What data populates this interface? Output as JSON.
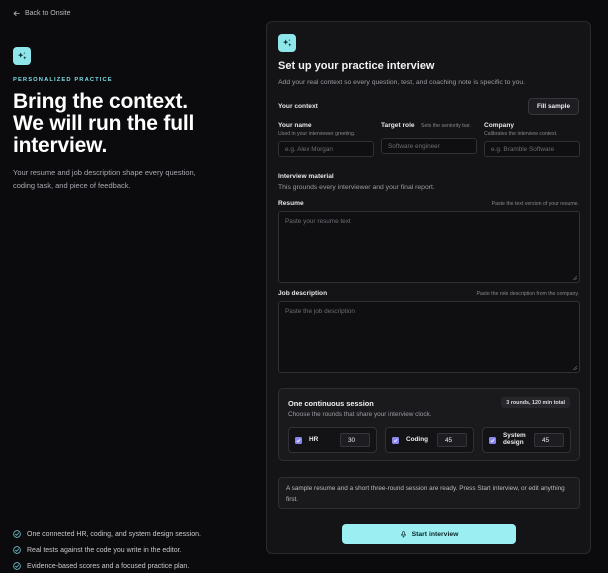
{
  "nav": {
    "back_label": "Back to Onsite"
  },
  "hero": {
    "kicker": "PERSONALIZED PRACTICE",
    "headline_lines": [
      "Bring the context.",
      "We will run the full",
      "interview."
    ],
    "lede": "Your resume and job description shape every question, coding task, and piece of feedback."
  },
  "features": [
    "One connected HR, coding, and system design session.",
    "Real tests against the code you write in the editor.",
    "Evidence-based scores and a focused practice plan."
  ],
  "form": {
    "title": "Set up your practice interview",
    "subtitle": "Add your real context so every question, test, and coaching note is specific to you.",
    "context_label": "Your context",
    "fill_sample": "Fill sample",
    "name": {
      "label": "Your name",
      "hint": "Used in your interviewer greeting.",
      "placeholder": "e.g. Alex Morgan"
    },
    "role": {
      "label": "Target role",
      "hint": "Sets the seniority bar.",
      "placeholder": "Software engineer"
    },
    "company": {
      "label": "Company",
      "hint": "Calibrates the interview context.",
      "placeholder": "e.g. Bramble Software"
    },
    "material": {
      "label": "Interview material",
      "sub": "This grounds every interviewer and your final report."
    },
    "resume": {
      "label": "Resume",
      "hint": "Paste the text version of your resume.",
      "placeholder": "Paste your resume text"
    },
    "job": {
      "label": "Job description",
      "hint": "Paste the role description from the company.",
      "placeholder": "Paste the job description"
    },
    "session": {
      "title": "One continuous session",
      "badge": "3 rounds, 120 min total",
      "sub": "Choose the rounds that share your interview clock.",
      "rounds": [
        {
          "name": "HR",
          "minutes": "30",
          "checked": true
        },
        {
          "name": "Coding",
          "minutes": "45",
          "checked": true
        },
        {
          "name": "System design",
          "minutes": "45",
          "checked": true
        }
      ]
    },
    "notice": "A sample resume and a short three-round session are ready. Press Start interview, or edit anything first.",
    "start_label": "Start interview"
  },
  "colors": {
    "accent": "#9beff3",
    "checkbox": "#8a86f0",
    "panel": "#141416",
    "background": "#0b0b0d"
  },
  "icons": {
    "back": "arrow-left-icon",
    "logo": "sparkles-icon",
    "feature": "check-circle-icon",
    "start": "microphone-icon"
  }
}
